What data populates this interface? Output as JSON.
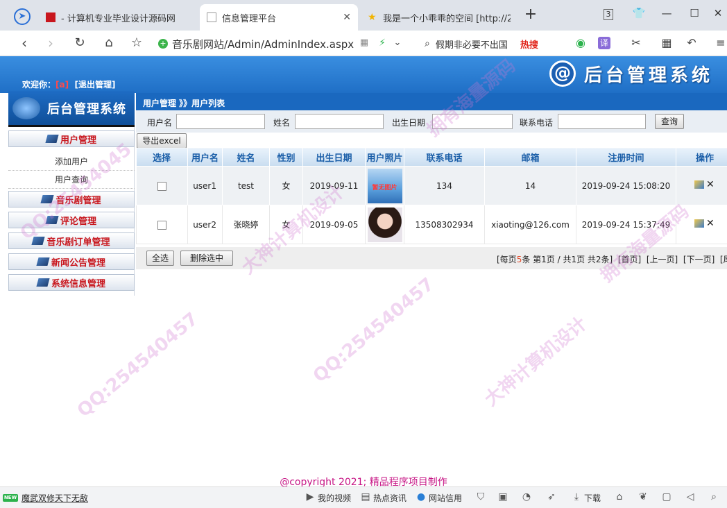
{
  "browser": {
    "tabs": [
      {
        "title": "- 计算机专业毕业设计源码网",
        "active": false
      },
      {
        "title": "信息管理平台",
        "active": true
      },
      {
        "title": "我是一个小乖乖的空间 [http://2",
        "active": false
      }
    ],
    "new_tab": "+",
    "tab_count": "3",
    "url": "音乐剧网站/Admin/AdminIndex.aspx",
    "search_text": "假期非必要不出国",
    "hot_label": "热搜"
  },
  "page": {
    "welcome_prefix": "欢迎你：",
    "username": "[a]",
    "logout": "[退出管理]",
    "brand_mark": "@",
    "brand_title": "后台管理系统",
    "breadcrumb": "用户管理 》》用户列表",
    "sidebar_title": "后台管理系统",
    "menu": [
      {
        "label": "用户管理"
      },
      {
        "label": "音乐剧管理"
      },
      {
        "label": "评论管理"
      },
      {
        "label": "音乐剧订单管理"
      },
      {
        "label": "新闻公告管理"
      },
      {
        "label": "系统信息管理"
      }
    ],
    "submenu": [
      "添加用户",
      "用户查询"
    ],
    "search": {
      "username_label": "用户名",
      "name_label": "姓名",
      "birth_label": "出生日期",
      "phone_label": "联系电话",
      "query_button": "查询",
      "export_button": "导出excel"
    },
    "table": {
      "headers": [
        "选择",
        "用户名",
        "姓名",
        "性别",
        "出生日期",
        "用户照片",
        "联系电话",
        "邮箱",
        "注册时间",
        "操作"
      ],
      "rows": [
        {
          "username": "user1",
          "name": "test",
          "gender": "女",
          "birth": "2019-09-11",
          "photo_text": "暂无图片",
          "phone": "134",
          "email": "14",
          "registered": "2019-09-24 15:08:20"
        },
        {
          "username": "user2",
          "name": "张晓婷",
          "gender": "女",
          "birth": "2019-09-05",
          "photo_text": "",
          "phone": "13508302934",
          "email": "xiaoting@126.com",
          "registered": "2019-09-24 15:37:49"
        }
      ]
    },
    "actions": {
      "select_all": "全选",
      "delete_selected": "删除选中"
    },
    "pager": {
      "pre": "[每页",
      "per_page": "5",
      "mid": "条 第1页 / 共1页 共2条]",
      "first": "[首页]",
      "prev": "[上一页]",
      "next": "[下一页]",
      "last": "[尾页]"
    },
    "copyright": "@copyright 2021; 精品程序项目制作"
  },
  "watermarks": [
    "QQ:25454045",
    "大神计算机设计",
    "拥有海量源码",
    "QQ:254540457"
  ],
  "statusbar": {
    "badge": "NEW",
    "news": "魔武双修天下无敌",
    "items": [
      "我的视频",
      "热点资讯",
      "网站信用",
      "下载"
    ]
  },
  "colors": {
    "header": "#1f6fc6",
    "menu_text": "#c8161d",
    "table_header_text": "#1a5ea8",
    "copyright": "#c71585",
    "watermark": "#d278d2"
  }
}
